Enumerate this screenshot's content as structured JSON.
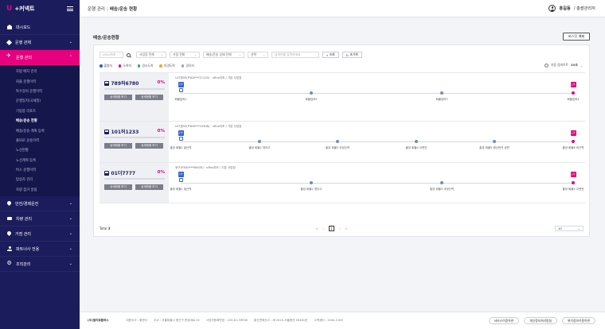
{
  "app": {
    "logo_u": "U",
    "logo_text": "+커넥트"
  },
  "sidebar": {
    "items": [
      {
        "label": "대시보드",
        "icon": "home-icon"
      },
      {
        "label": "운행 관제",
        "icon": "diamond-icon"
      },
      {
        "label": "운행 관리",
        "icon": "plane-icon"
      },
      {
        "label": "안전/경제운전",
        "icon": "pin-icon"
      },
      {
        "label": "차량 관리",
        "icon": "truck-icon"
      },
      {
        "label": "거점 관리",
        "icon": "pin-icon"
      },
      {
        "label": "파트너사 전용",
        "icon": "user-icon"
      },
      {
        "label": "조직관리",
        "icon": "gear-icon"
      }
    ],
    "sub_items": [
      "차량 배차 관리",
      "회물 운행이력",
      "특수장비 운행이력",
      "운행일지(국세청)",
      "기동봉 리포트",
      "배송/운송 현황",
      "배송/운송 계획 등록",
      "출퇴로 운송이력",
      "노선현황",
      "노선계획 등록",
      "버스 운행이력",
      "탑승자 관리",
      "차량 점거 알림"
    ]
  },
  "topbar": {
    "crumb_parent": "운행 관리",
    "crumb_current": "배송/운송 현황",
    "user_name": "홍길동",
    "user_role": "/ 총괄관리자"
  },
  "main": {
    "page_title": "배송/운송현황",
    "guide_button": "버스진 예제",
    "filters": {
      "vehicle_placeholder": "uRns차초",
      "business_type": "사업장 전체",
      "route_all": "거점 전체",
      "status_all": "배송/운송 상태 전체",
      "select": "선택",
      "keyword_placeholder": "검색어를 입력하세요",
      "search_label": "조회",
      "reset_label": "초기화"
    },
    "legend": [
      {
        "label": "출발지",
        "color": "#2f5fd3"
      },
      {
        "label": "도착지",
        "color": "#e6007e"
      },
      {
        "label": "경시도착",
        "color": "#2fae5c"
      },
      {
        "label": "미경도착",
        "color": "#f5a623"
      },
      {
        "label": "경유지",
        "color": "#9aa3b2"
      }
    ],
    "refresh_label": "자동 업데이트",
    "refresh_interval": "30초",
    "detail_label": "상세현황 보기",
    "status_label": "상세현황 보기",
    "vehicles": [
      {
        "plate": "789허6780",
        "percent": "0%",
        "info": "ULT경05(P3D0***21120) · uRns차초 / 기본 사업장",
        "stops": [
          "회물집하1",
          "회물집하2",
          "회물집하3",
          "회물집하4"
        ]
      },
      {
        "plate": "101허1233",
        "percent": "0%",
        "info": "ULT경05(P3D0***10308) · uRns차초 / 기본 사업장",
        "stops": [
          "출장 회물1 발산역",
          "출장 회물2 영어고",
          "출장 회물3 국정산역",
          "출장 회물4 오렌전",
          "출장 회물5 원산번전 공판",
          "출장 회물6 비곤역"
        ]
      },
      {
        "plate": "01더7777",
        "percent": "0%",
        "info": "위구(P3D0***08435) · uRns차초 / 기본 사업장",
        "stops": [
          "출장 회물1 발산역",
          "출장 회물2 영어고",
          "출장 회물3 국정산역",
          "출장 회물4 오렌전"
        ]
      }
    ],
    "bus_marker": "출발",
    "end_marker": "도착",
    "total_label": "Total",
    "total_count": "3",
    "current_page": "1",
    "per_page": "10"
  },
  "footer": {
    "corp": "(주)엘지유플러스",
    "ceo": "대표이사 : 황현식",
    "address": "주소 : 서울특별시 용산구 한강대로 32",
    "biz_no": "사업자등록번호 : 220-81-39938",
    "mail_order": "통신판매신고 : 제 2015-서울용산-00481호",
    "phone": "고객센터 : 1544-1163",
    "links": [
      "서비스이용약관",
      "개인정보처리방침",
      "위치정보이용약관"
    ]
  }
}
